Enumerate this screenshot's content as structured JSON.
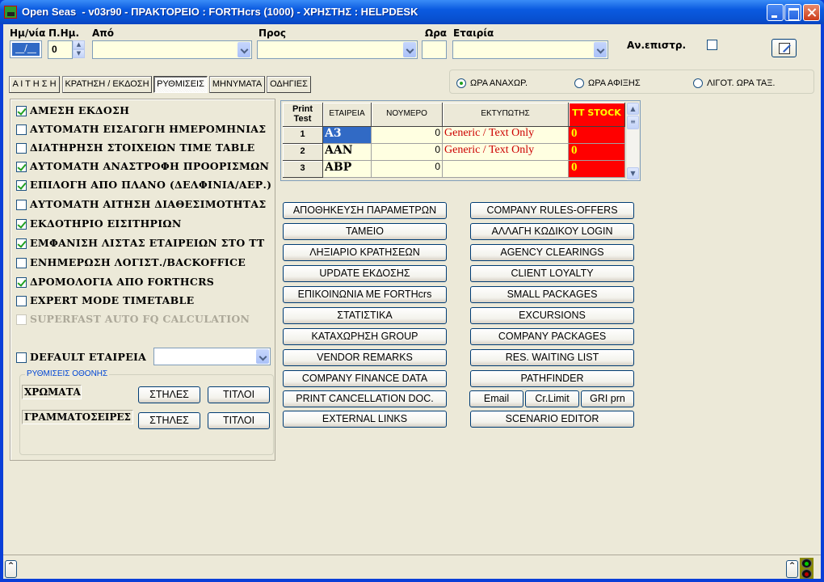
{
  "window": {
    "title": "Open Seas  - v03r90 - ΠΡΑΚΤΟΡΕΙΟ : FORTHcrs (1000) - ΧΡΗΣΤΗΣ : HELPDESK"
  },
  "header": {
    "date_label": "Ημ/νία",
    "days_label": "Π.Ημ.",
    "from_label": "Από",
    "to_label": "Προς",
    "time_label": "Ωρα",
    "company_label": "Εταιρία",
    "return_label": "Αν.επιστρ.",
    "date_value": "__/__",
    "days_value": "0",
    "from_value": "",
    "to_value": "",
    "time_value": "",
    "company_value": "",
    "return_checked": false
  },
  "tabs": [
    {
      "label": "Α Ι Τ Η Σ Η",
      "active": false
    },
    {
      "label": "ΚΡΑΤΗΣΗ / ΕΚΔΟΣΗ",
      "active": false
    },
    {
      "label": "ΡΥΘΜΙΣΕΙΣ",
      "active": true
    },
    {
      "label": "ΜΗΝΥΜΑΤΑ",
      "active": false
    },
    {
      "label": "ΟΔΗΓΙΕΣ",
      "active": false
    }
  ],
  "time_mode": {
    "options": [
      {
        "label": "ΩΡΑ ΑΝΑΧΩΡ.",
        "selected": true
      },
      {
        "label": "ΩΡΑ ΑΦΙΞΗΣ",
        "selected": false
      },
      {
        "label": "ΛΙΓΟΤ. ΩΡΑ ΤΑΞ.",
        "selected": false
      }
    ]
  },
  "settings": {
    "options": [
      {
        "label": "ΑΜΕΣΗ ΕΚΔΟΣΗ",
        "checked": true,
        "disabled": false
      },
      {
        "label": "ΑΥΤΟΜΑΤΗ ΕΙΣΑΓΩΓΗ ΗΜΕΡΟΜΗΝΙΑΣ",
        "checked": false,
        "disabled": false
      },
      {
        "label": "ΔΙΑΤΗΡΗΣΗ ΣΤΟΙΧΕΙΩΝ TIME TABLE",
        "checked": false,
        "disabled": false
      },
      {
        "label": "ΑΥΤΟΜΑΤΗ ΑΝΑΣΤΡΟΦΗ ΠΡΟΟΡΙΣΜΩΝ",
        "checked": true,
        "disabled": false
      },
      {
        "label": "ΕΠΙΛΟΓΗ ΑΠΟ ΠΛΑΝΟ (ΔΕΛΦΙΝΙΑ/ΑΕΡ.)",
        "checked": true,
        "disabled": false
      },
      {
        "label": "ΑΥΤΟΜΑΤΗ ΑΙΤΗΣΗ ΔΙΑΘΕΣΙΜΟΤΗΤΑΣ",
        "checked": false,
        "disabled": false
      },
      {
        "label": "ΕΚΔΟΤΗΡΙΟ ΕΙΣΙΤΗΡΙΩΝ",
        "checked": true,
        "disabled": false
      },
      {
        "label": "ΕΜΦΑΝΙΣΗ ΛΙΣΤΑΣ ΕΤΑΙΡΕΙΩΝ ΣΤΟ ΤΤ",
        "checked": true,
        "disabled": false
      },
      {
        "label": "ΕΝΗΜΕΡΩΣΗ ΛΟΓΙΣΤ./BACKOFFICE",
        "checked": false,
        "disabled": false
      },
      {
        "label": "ΔΡΟΜΟΛΟΓΙΑ ΑΠΟ FORTHCRS",
        "checked": true,
        "disabled": false
      },
      {
        "label": "EXPERT MODE TIMETABLE",
        "checked": false,
        "disabled": false
      },
      {
        "label": "SUPERFAST AUTO FQ CALCULATION",
        "checked": false,
        "disabled": true
      }
    ],
    "default_company_label": "DEFAULT ΕΤΑΙΡΕΙΑ",
    "default_company_checked": false,
    "default_company_value": "",
    "screen_group_title": "ΡΥΘΜΙΣΕΙΣ ΟΘΟΝΗΣ",
    "colors_label": "ΧΡΩΜΑΤΑ",
    "fonts_label": "ΓΡΑΜΜΑΤΟΣΕΙΡΕΣ",
    "columns_button": "ΣΤΗΛΕΣ",
    "titles_button": "ΤΙΤΛΟΙ"
  },
  "printer_grid": {
    "columns": [
      "Print\nTest",
      "ΕΤΑΙΡΕΙΑ",
      "ΝΟΥΜΕΡΟ",
      "ΕΚΤΥΠΩΤΗΣ",
      "TT STOCK"
    ],
    "rows": [
      {
        "index": "1",
        "company": "A3",
        "number": "0",
        "printer": "Generic / Text Only",
        "stock": "0"
      },
      {
        "index": "2",
        "company": "AAN",
        "number": "0",
        "printer": "Generic / Text Only",
        "stock": "0"
      },
      {
        "index": "3",
        "company": "ABP",
        "number": "0",
        "printer": "",
        "stock": "0"
      }
    ]
  },
  "actions_left": [
    "ΑΠΟΘΗΚΕΥΣΗ ΠΑΡΑΜΕΤΡΩΝ",
    "ΤΑΜΕΙΟ",
    "ΛΗΞΙΑΡΙΟ ΚΡΑΤΗΣΕΩΝ",
    "UPDATE ΕΚΔΟΣΗΣ",
    "ΕΠΙΚΟΙΝΩΝΙΑ ΜΕ FORTHcrs",
    "ΣΤΑΤΙΣΤΙΚΑ",
    "ΚΑΤΑΧΩΡΗΣΗ GROUP",
    "VENDOR REMARKS",
    "COMPANY FINANCE DATA",
    "PRINT CANCELLATION DOC.",
    "EXTERNAL LINKS"
  ],
  "actions_right": [
    "COMPANY RULES-OFFERS",
    "ΑΛΛΑΓΗ ΚΩΔΙΚΟΥ LOGIN",
    "AGENCY CLEARINGS",
    "CLIENT LOYALTY",
    "SMALL PACKAGES",
    "EXCURSIONS",
    "COMPANY PACKAGES",
    "RES. WAITING LIST",
    "PATHFINDER"
  ],
  "small_actions": [
    "Email",
    "Cr.Limit",
    "GRI prn"
  ],
  "scenario_button": "SCENARIO EDITOR",
  "colors": {
    "stock_bg": "#ff0000",
    "stock_fg": "#ffff00",
    "printer_text": "#cc0000",
    "field_bg": "#ffffe1",
    "selection": "#316ac5"
  }
}
